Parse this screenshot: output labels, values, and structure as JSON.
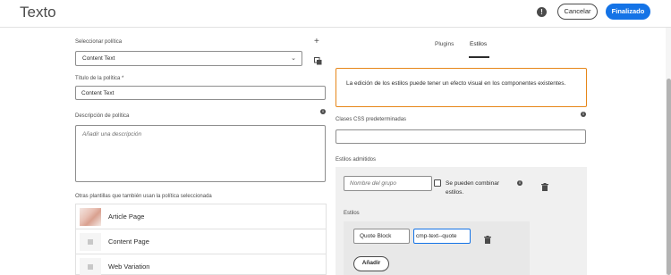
{
  "header": {
    "title": "Texto",
    "cancel_label": "Cancelar",
    "done_label": "Finalizado"
  },
  "left": {
    "select_policy_label": "Seleccionar política",
    "select_policy_value": "Content Text",
    "policy_title_label": "Título de la política *",
    "policy_title_value": "Content Text",
    "description_label": "Descripción de política",
    "description_placeholder": "Añadir una descripción",
    "other_templates_label": "Otras plantillas que también usan la política seleccionada",
    "pages": [
      {
        "name": "Article Page"
      },
      {
        "name": "Content Page"
      },
      {
        "name": "Web Variation"
      }
    ]
  },
  "right": {
    "tabs": [
      {
        "label": "Plugins"
      },
      {
        "label": "Estilos"
      }
    ],
    "warning_text": "La edición de los estilos puede tener un efecto visual en los componentes existentes.",
    "default_css_label": "Clases CSS predeterminadas",
    "default_css_value": "",
    "allowed_styles_label": "Estilos admitidos",
    "group_name_placeholder": "Nombre del grupo",
    "combinable_label": "Se pueden combinar estilos.",
    "styles_label": "Estilos",
    "style_name_value": "Quote Block",
    "style_class_value": "cmp-text--quote",
    "add_label": "Añadir"
  },
  "colors": {
    "accent": "#1473e6",
    "warning_border": "#e68619"
  }
}
